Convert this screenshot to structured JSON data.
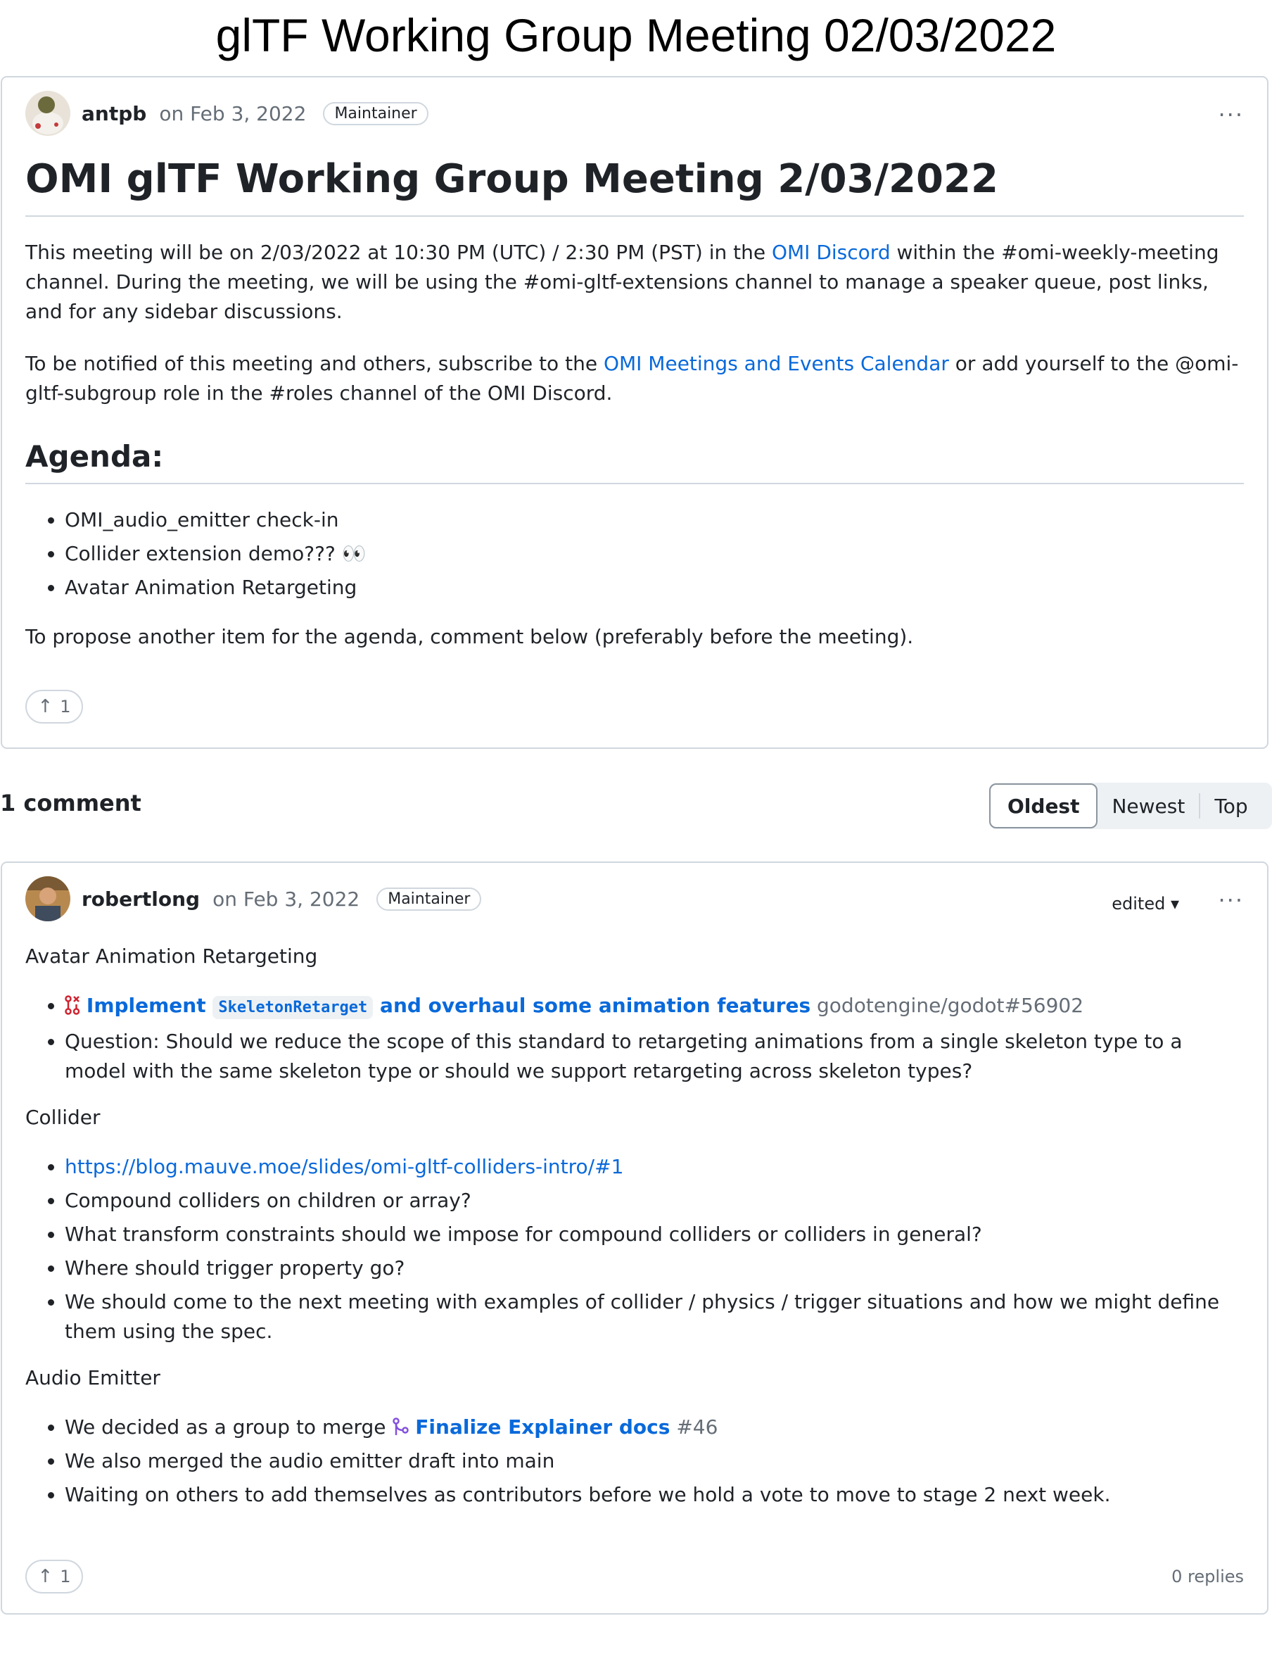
{
  "page_title": "glTF Working Group Meeting 02/03/2022",
  "post": {
    "author": "antpb",
    "date": "on Feb 3, 2022",
    "badge": "Maintainer",
    "more": "···",
    "title": "OMI glTF Working Group Meeting 2/03/2022",
    "p1_a": "This meeting will be on 2/03/2022 at 10:30 PM (UTC) / 2:30 PM (PST) in the ",
    "p1_link": "OMI Discord",
    "p1_b": " within the #omi-weekly-meeting channel. During the meeting, we will be using the #omi-gltf-extensions channel to manage a speaker queue, post links, and for any sidebar discussions.",
    "p2_a": "To be notified of this meeting and others, subscribe to the ",
    "p2_link": "OMI Meetings and Events Calendar",
    "p2_b": " or add yourself to the @omi-gltf-subgroup role in the #roles channel of the OMI Discord.",
    "agenda_heading": "Agenda:",
    "agenda_items": [
      "OMI_audio_emitter check-in",
      "Collider extension demo??? 👀",
      "Avatar Animation Retargeting"
    ],
    "propose": "To propose another item for the agenda, comment below (preferably before the meeting).",
    "votes": "1"
  },
  "comments_bar": {
    "count": "1 comment",
    "sort_options": [
      "Oldest",
      "Newest",
      "Top"
    ],
    "active_sort": "Oldest"
  },
  "comment": {
    "author": "robertlong",
    "date": "on Feb 3, 2022",
    "badge": "Maintainer",
    "edited": "edited ▾",
    "more": "···",
    "section1": "Avatar Animation Retargeting",
    "pr1_a": "Implement ",
    "pr1_code": "SkeletonRetarget",
    "pr1_b": " and overhaul some animation features",
    "pr1_ref": " godotengine/godot#56902",
    "q1": "Question: Should we reduce the scope of this standard to retargeting animations from a single skeleton type to a model with the same skeleton type or should we support retargeting across skeleton types?",
    "section2": "Collider",
    "collider_link": "https://blog.mauve.moe/slides/omi-gltf-colliders-intro/#1",
    "collider_items": [
      "Compound colliders on children or array?",
      "What transform constraints should we impose for compound colliders or colliders in general?",
      "Where should trigger property go?",
      "We should come to the next meeting with examples of collider / physics / trigger situations and how we might define them using the spec."
    ],
    "section3": "Audio Emitter",
    "audio_a": "We decided as a group to merge ",
    "audio_link": "Finalize Explainer docs",
    "audio_ref": " #46",
    "audio_items": [
      "We also merged the audio emitter draft into main",
      "Waiting on others to add themselves as contributors before we hold a vote to move to stage 2 next week."
    ],
    "votes": "1",
    "replies": "0 replies"
  },
  "colors": {
    "link": "#0969da",
    "border": "#d0d7de",
    "muted": "#656d76",
    "pr_closed": "#cf222e",
    "pr_merged": "#8250df"
  }
}
